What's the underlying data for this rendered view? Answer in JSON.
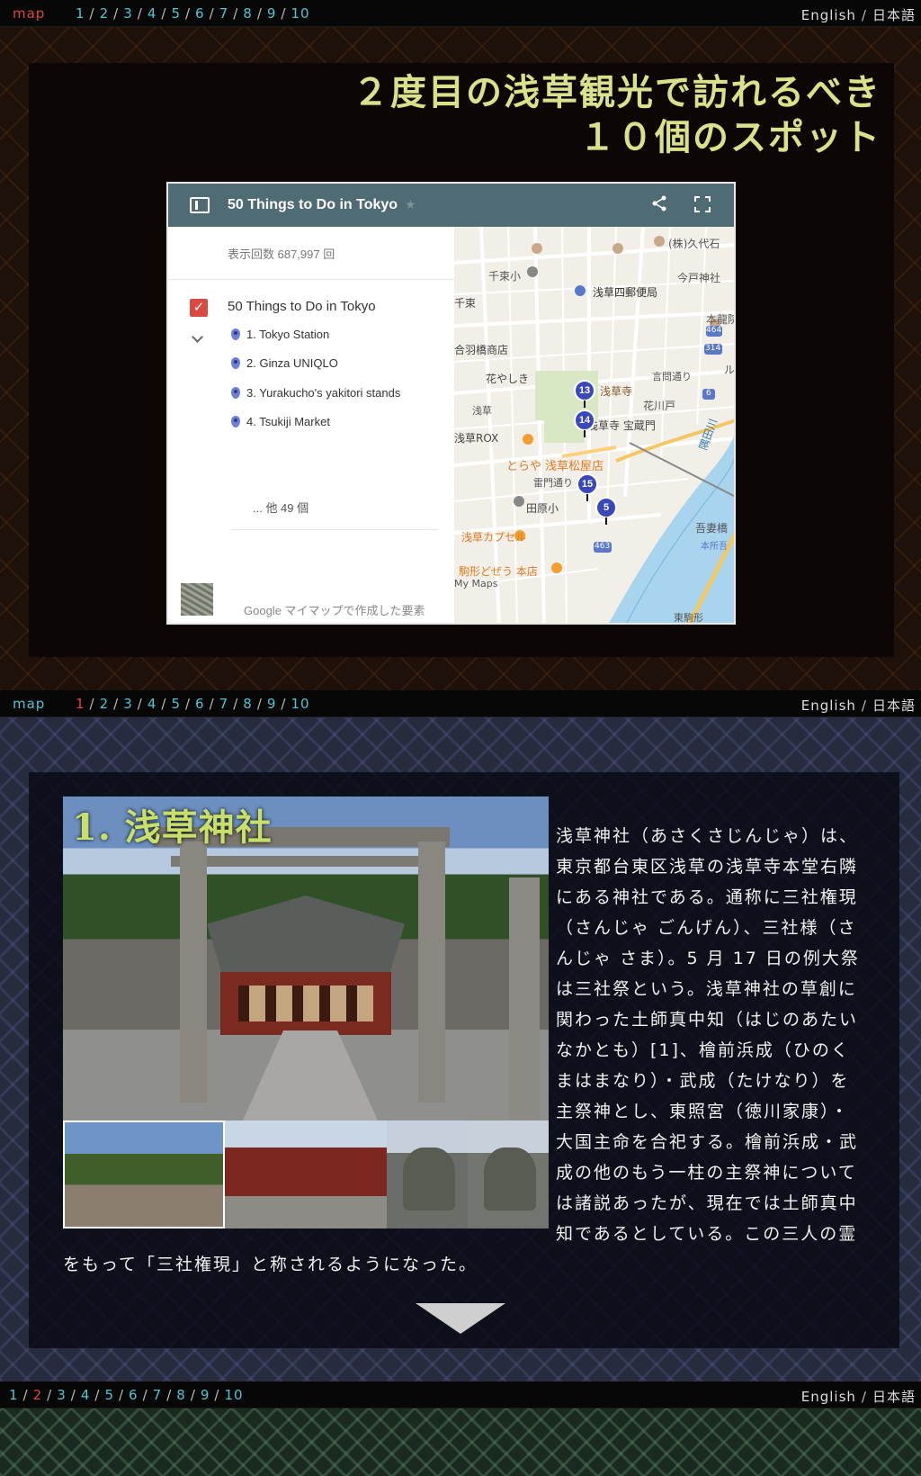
{
  "nav1": {
    "map_label": "map",
    "pages": [
      "1",
      "2",
      "3",
      "4",
      "5",
      "6",
      "7",
      "8",
      "9",
      "10"
    ],
    "active": "",
    "lang": [
      "English",
      "日本語"
    ]
  },
  "section1": {
    "title_line1": "２度目の浅草観光で訪れるべき",
    "title_line2": "１０個のスポット",
    "map": {
      "title": "50 Things to Do in Tokyo",
      "views": "表示回数 687,997 回",
      "layer_title": "50 Things to Do in Tokyo",
      "items": [
        "1. Tokyo Station",
        "2. Ginza UNIQLO",
        "3. Yurakucho's yakitori stands",
        "4. Tsukiji Market"
      ],
      "more": "... 他 49 個",
      "credit": "Google マイマップで作成した要素",
      "markers": [
        "13",
        "14",
        "15",
        "5"
      ],
      "labels": [
        "千束小",
        "浅草四郵便局",
        "(株)久代石",
        "今戸神社",
        "本龍院",
        "花やしき",
        "浅草寺",
        "花川戸",
        "浅草寺 宝蔵門",
        "隅田川",
        "浅草ROX",
        "とらや 浅草松屋店",
        "雷門通り",
        "田原小",
        "浅草カプセル",
        "駒形どぜう 本店",
        "吾妻橋",
        "東駒形",
        "千束",
        "合羽橋商店",
        "言問通り",
        "浅草",
        "My Maps",
        "本所吾",
        "ル"
      ],
      "road_numbers": [
        "464",
        "314",
        "6",
        "463"
      ]
    }
  },
  "nav2": {
    "map_label": "map",
    "pages": [
      "1",
      "2",
      "3",
      "4",
      "5",
      "6",
      "7",
      "8",
      "9",
      "10"
    ],
    "active": "1",
    "lang": [
      "English",
      "日本語"
    ]
  },
  "section2": {
    "title": "1. 浅草神社",
    "description": "浅草神社（あさくさじんじゃ）は、東京都台東区浅草の浅草寺本堂右隣にある神社である。通称に三社権現（さんじゃ ごんげん）、三社様（さんじゃ さま）。5 月 17 日の例大祭は三社祭という。浅草神社の草創に関わった土師真中知（はじのあたいなかとも）[1]、檜前浜成（ひのくまはまなり）・武成（たけなり）を主祭神とし、東照宮（徳川家康）・大国主命を合祀する。檜前浜成・武成の他のもう一柱の主祭神については諸説あったが、現在では土師真中知であるとしている。この三人の霊をもって「三社権現」と称されるようになった。"
  },
  "nav3": {
    "pages": [
      "1",
      "2",
      "3",
      "4",
      "5",
      "6",
      "7",
      "8",
      "9",
      "10"
    ],
    "active": "2",
    "lang": [
      "English",
      "日本語"
    ]
  }
}
